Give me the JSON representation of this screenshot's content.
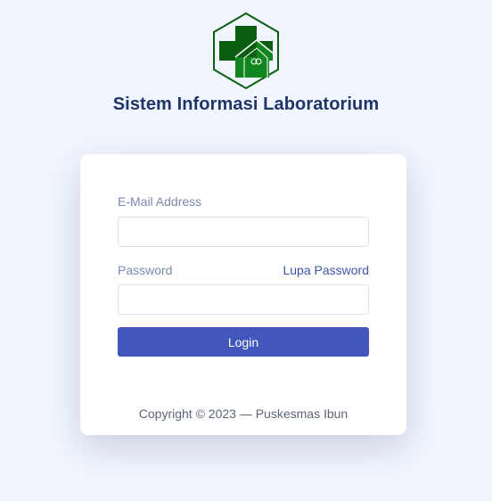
{
  "app": {
    "title": "Sistem Informasi Laboratorium"
  },
  "logo": {
    "icon": "health-cross-house-icon",
    "colors": {
      "outline": "#0b5d12",
      "cross_dark": "#0b5d12",
      "cross_light": "#12861e"
    }
  },
  "form": {
    "email_label": "E-Mail Address",
    "email_value": "",
    "password_label": "Password",
    "password_value": "",
    "forgot_label": "Lupa Password",
    "login_label": "Login"
  },
  "footer": {
    "copyright": "Copyright © 2023 — Puskesmas Ibun"
  },
  "colors": {
    "background": "#f0f5fe",
    "title": "#1f3568",
    "primary": "#4257bc",
    "link": "#3d56b0",
    "label": "#7a89ad"
  }
}
